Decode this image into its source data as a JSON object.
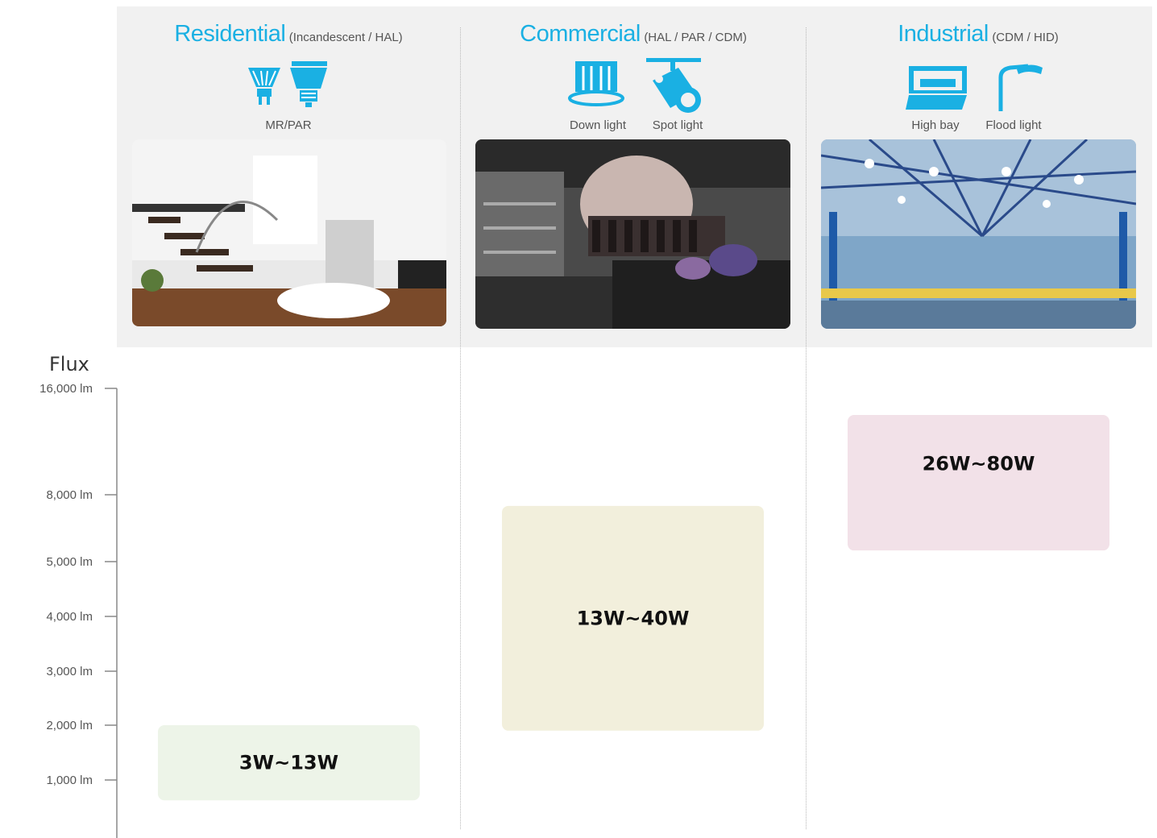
{
  "categories": [
    {
      "name": "Residential",
      "sub": "(Incandescent / HAL)",
      "icons": [
        {
          "icon": "mr-par-bulb-icon",
          "label": "MR/PAR"
        }
      ]
    },
    {
      "name": "Commercial",
      "sub": "(HAL / PAR / CDM)",
      "icons": [
        {
          "icon": "down-light-icon",
          "label": "Down light"
        },
        {
          "icon": "spot-light-icon",
          "label": "Spot light"
        }
      ]
    },
    {
      "name": "Industrial",
      "sub": "(CDM / HID)",
      "icons": [
        {
          "icon": "high-bay-icon",
          "label": "High bay"
        },
        {
          "icon": "flood-light-icon",
          "label": "Flood light"
        }
      ]
    }
  ],
  "colors": {
    "accent": "#1ab0e3",
    "residential_box": "#edf4e8",
    "commercial_box": "#f2efdc",
    "industrial_box": "#f2e1e8"
  },
  "chart_data": {
    "type": "bar",
    "ylabel": "Flux",
    "y_ticks": [
      {
        "value": 1000,
        "label": "1,000 lm"
      },
      {
        "value": 2000,
        "label": "2,000 lm"
      },
      {
        "value": 3000,
        "label": "3,000 lm"
      },
      {
        "value": 4000,
        "label": "4,000 lm"
      },
      {
        "value": 5000,
        "label": "5,000 lm"
      },
      {
        "value": 8000,
        "label": "8,000 lm"
      },
      {
        "value": 16000,
        "label": "16,000 lm"
      }
    ],
    "ranges": [
      {
        "category": "Residential",
        "label": "3W~13W",
        "low": 650,
        "high": 2000
      },
      {
        "category": "Commercial",
        "label": "13W~40W",
        "low": 1900,
        "high": 7500
      },
      {
        "category": "Industrial",
        "label": "26W~80W",
        "low": 5500,
        "high": 14000
      }
    ]
  }
}
